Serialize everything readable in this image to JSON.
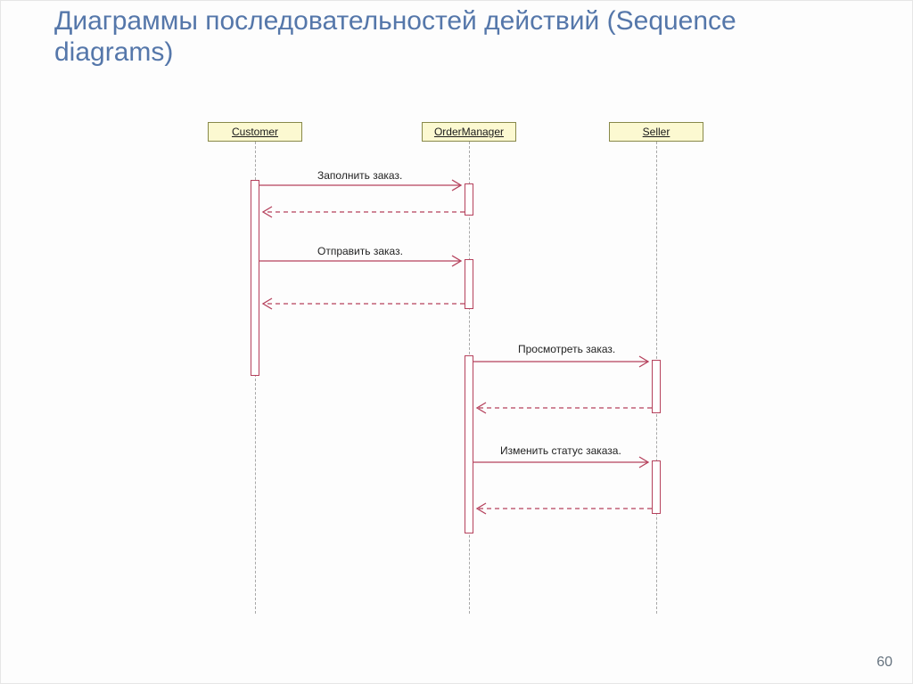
{
  "title": "Диаграммы последовательностей действий (Sequence diagrams)",
  "page_number": "60",
  "diagram": {
    "actors": {
      "customer": "Customer",
      "order_manager": "OrderManager",
      "seller": "Seller"
    },
    "messages": {
      "fill_order": "Заполнить заказ.",
      "send_order": "Отправить заказ.",
      "view_order": "Просмотреть заказ.",
      "change_status": "Изменить статус заказа."
    }
  }
}
